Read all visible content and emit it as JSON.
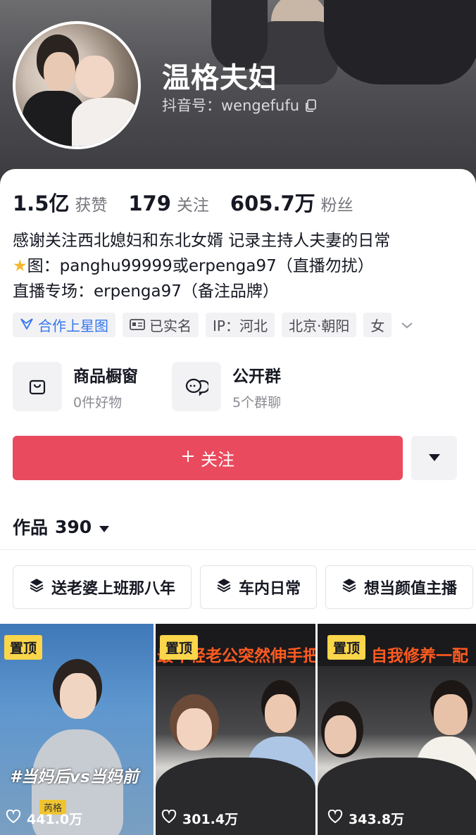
{
  "profile": {
    "name": "温格夫妇",
    "douyin_id": "抖音号：wengefufu"
  },
  "stats": [
    {
      "value": "1.5亿",
      "label": "获赞"
    },
    {
      "value": "179",
      "label": "关注"
    },
    {
      "value": "605.7万",
      "label": "粉丝"
    }
  ],
  "bio": [
    "感谢关注西北媳妇和东北女婿 记录主持人夫妻的日常",
    "图：panghu99999或erpenga97（直播勿扰）",
    "直播专场：erpenga97（备注品牌）"
  ],
  "tags": {
    "cooperation": "合作上星图",
    "verified": "已实名",
    "ip": "IP：河北",
    "location": "北京·朝阳",
    "gender": "女"
  },
  "services": [
    {
      "title": "商品橱窗",
      "sub": "0件好物"
    },
    {
      "title": "公开群",
      "sub": "5个群聊"
    }
  ],
  "follow_label": "关注",
  "works": {
    "label": "作品",
    "count": "390"
  },
  "collections": [
    "送老婆上班那八年",
    "车内日常",
    "想当颜值主播"
  ],
  "videos": [
    {
      "pin": "置顶",
      "banner": "",
      "hashtag": "#当妈后vs当妈前",
      "anchor": "芮格",
      "plays": "441.0万"
    },
    {
      "pin": "置顶",
      "banner": "最年轻老公突然伸手把",
      "plays": "301.4万"
    },
    {
      "pin": "置顶",
      "banner": "自我修养一配",
      "plays": "343.8万"
    }
  ],
  "colors": {
    "follow": "#ea4a5d",
    "pin": "#fbd54a",
    "link_blue": "#3477f0"
  }
}
